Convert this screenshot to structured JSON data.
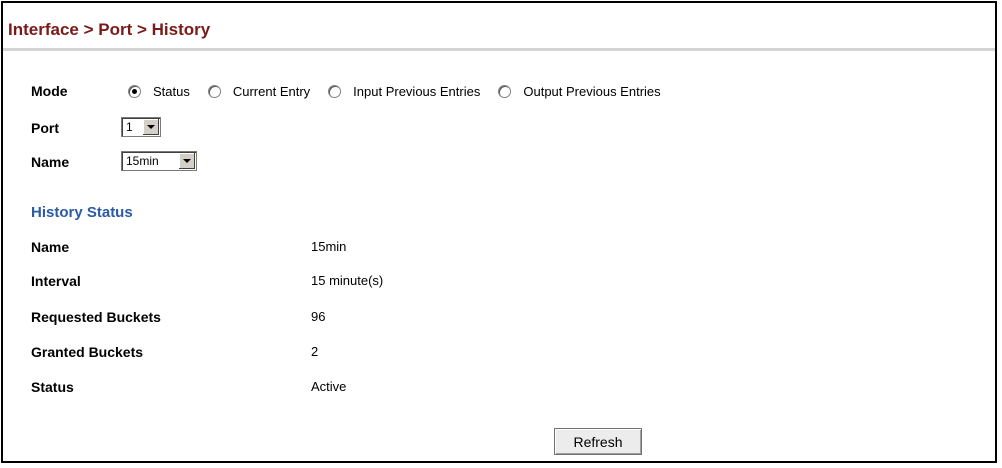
{
  "breadcrumb": "Interface > Port > History",
  "form": {
    "mode_label": "Mode",
    "mode_options": [
      "Status",
      "Current Entry",
      "Input Previous Entries",
      "Output Previous Entries"
    ],
    "mode_selected": "Status",
    "port_label": "Port",
    "port_value": "1",
    "name_label": "Name",
    "name_value": "15min"
  },
  "history_status": {
    "title": "History Status",
    "rows": [
      {
        "label": "Name",
        "value": "15min"
      },
      {
        "label": "Interval",
        "value": "15 minute(s)"
      },
      {
        "label": "Requested Buckets",
        "value": "96"
      },
      {
        "label": "Granted Buckets",
        "value": "2"
      },
      {
        "label": "Status",
        "value": "Active"
      }
    ]
  },
  "refresh_label": "Refresh",
  "colors": {
    "breadcrumb": "#7a1a1a",
    "section_title": "#2a5aa8"
  }
}
